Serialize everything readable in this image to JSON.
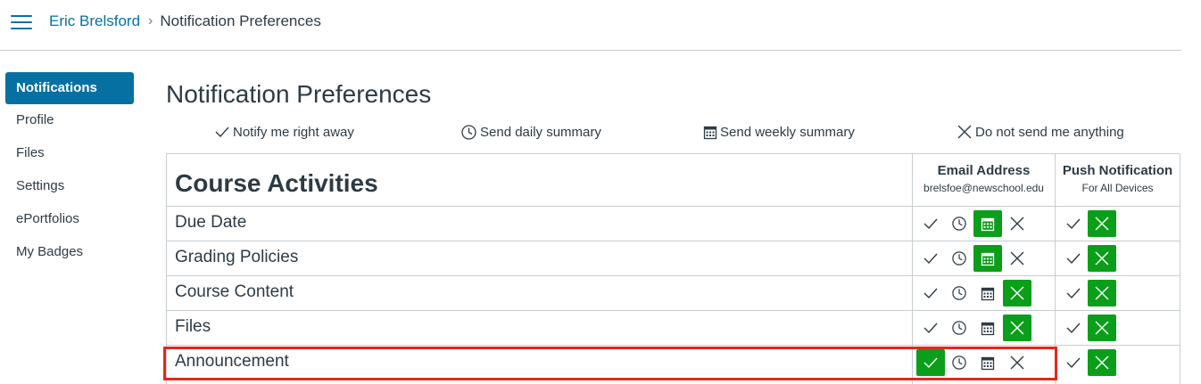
{
  "breadcrumb": {
    "user": "Eric Brelsford",
    "current": "Notification Preferences"
  },
  "sidebar": {
    "items": [
      {
        "label": "Notifications",
        "active": true
      },
      {
        "label": "Profile"
      },
      {
        "label": "Files"
      },
      {
        "label": "Settings"
      },
      {
        "label": "ePortfolios"
      },
      {
        "label": "My Badges"
      }
    ]
  },
  "page_title": "Notification Preferences",
  "legend": {
    "right_away": "Notify me right away",
    "daily": "Send daily summary",
    "weekly": "Send weekly summary",
    "never": "Do not send me anything"
  },
  "table": {
    "section_title": "Course Activities",
    "email_col": {
      "title": "Email Address",
      "subtitle": "brelsfoe@newschool.edu"
    },
    "push_col": {
      "title": "Push Notification",
      "subtitle": "For All Devices"
    },
    "rows": [
      {
        "label": "Due Date",
        "email": "weekly",
        "push": "never"
      },
      {
        "label": "Grading Policies",
        "email": "weekly",
        "push": "never"
      },
      {
        "label": "Course Content",
        "email": "never",
        "push": "never"
      },
      {
        "label": "Files",
        "email": "never",
        "push": "never"
      },
      {
        "label": "Announcement",
        "email": "right_away",
        "push": "never"
      }
    ]
  },
  "colors": {
    "accent": "#0770a3",
    "selected": "#0b9e1a",
    "highlight": "#e0291c",
    "text": "#2d3b45"
  }
}
